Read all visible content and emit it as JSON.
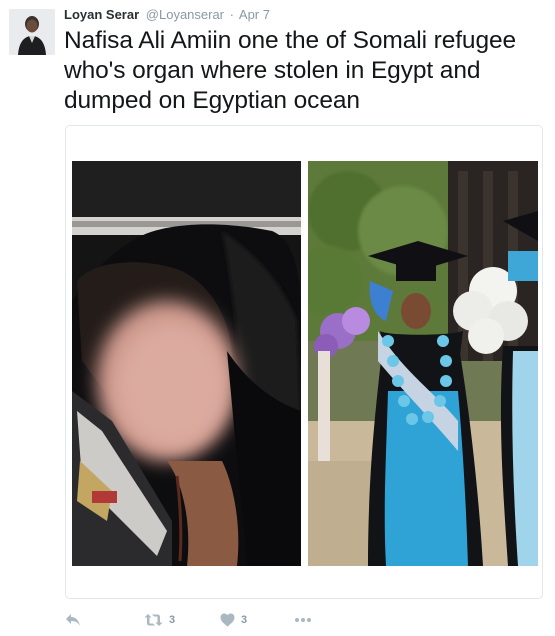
{
  "tweet": {
    "display_name": "Loyan Serar",
    "username": "@Loyanserar",
    "separator": "·",
    "timestamp": "Apr 7",
    "text": "Nafisa Ali Amiin one the of Somali refugee who's organ where stolen in Egypt and dumped on Egyptian ocean"
  },
  "media": {
    "photos": [
      {
        "name": "photo-body-blurred-face",
        "icon": "photo"
      },
      {
        "name": "photo-graduation-gown",
        "icon": "photo"
      }
    ]
  },
  "actions": {
    "reply_icon": "reply-icon",
    "retweet_icon": "retweet-icon",
    "retweet_count": "3",
    "like_icon": "heart-icon",
    "like_count": "3",
    "more_icon": "more-icon"
  },
  "colors": {
    "text": "#14171a",
    "muted": "#8899a6",
    "icon": "#aab8c2",
    "border": "#e1e8ed"
  }
}
